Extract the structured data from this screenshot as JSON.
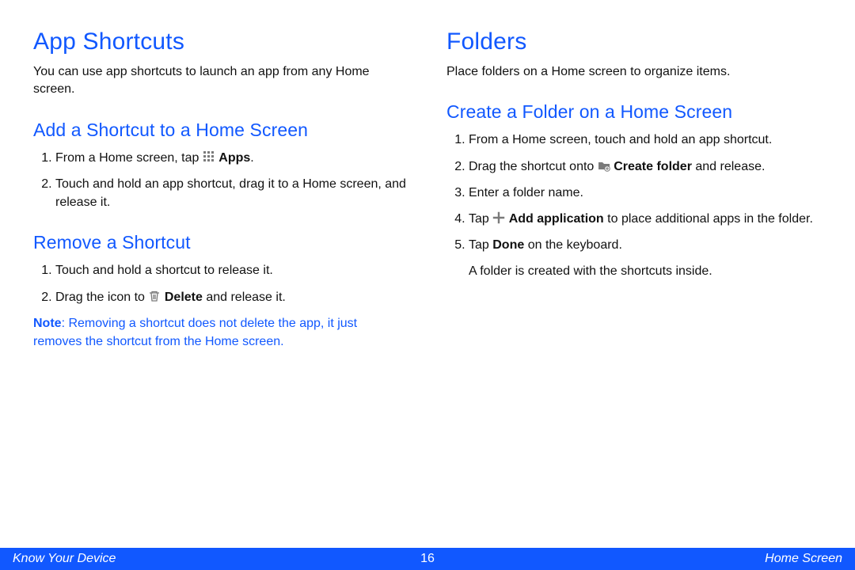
{
  "left": {
    "h1": "App Shortcuts",
    "intro": "You can use app shortcuts to launch an app from any Home screen.",
    "section_add": {
      "h2": "Add a Shortcut to a Home Screen",
      "step1_a": "From a Home screen, tap ",
      "step1_bold": "Apps",
      "step1_b": ".",
      "step2": "Touch and hold an app shortcut, drag it to a Home screen, and release it."
    },
    "section_remove": {
      "h2": "Remove a Shortcut",
      "step1": "Touch and hold a shortcut to release it.",
      "step2_a": "Drag the icon to ",
      "step2_bold": "Delete",
      "step2_b": " and release it.",
      "note_label": "Note",
      "note_text": ": Removing a shortcut does not delete the app, it just removes the shortcut from the Home screen."
    }
  },
  "right": {
    "h1": "Folders",
    "intro": "Place folders on a Home screen to organize items.",
    "section_create": {
      "h2": "Create a Folder on a Home Screen",
      "step1": "From a Home screen, touch and hold an app shortcut.",
      "step2_a": "Drag the shortcut onto ",
      "step2_bold": "Create folder",
      "step2_b": " and release.",
      "step3": "Enter a folder name.",
      "step4_a": "Tap ",
      "step4_bold": "Add application",
      "step4_b": " to place additional apps in the folder.",
      "step5_a": "Tap ",
      "step5_bold": "Done",
      "step5_b": " on the keyboard.",
      "after": "A folder is created with the shortcuts inside."
    }
  },
  "footer": {
    "left": "Know Your Device",
    "page": "16",
    "right": "Home Screen"
  }
}
